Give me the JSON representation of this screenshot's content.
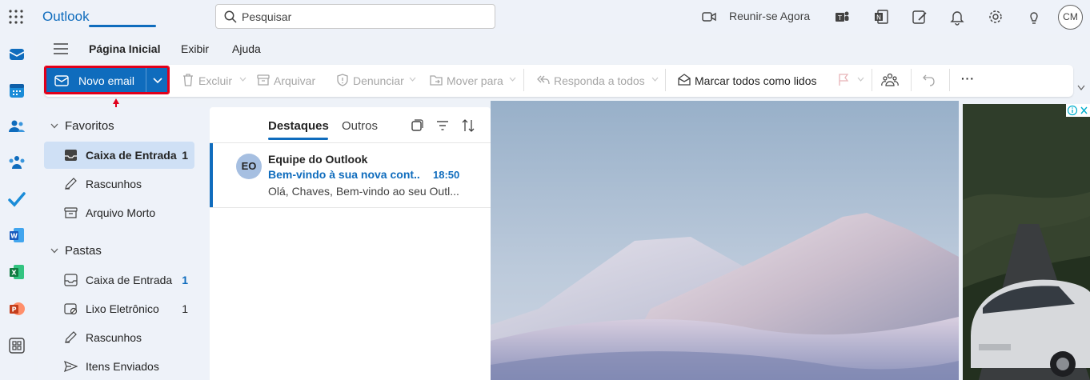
{
  "app": {
    "name": "Outlook"
  },
  "topbar": {
    "search_placeholder": "Pesquisar",
    "meet_now_label": "Reunir-se Agora",
    "avatar_initials": "CM",
    "icons": [
      "waffle-icon",
      "video-icon",
      "teams-icon",
      "onenote-icon",
      "notes-icon",
      "bell-icon",
      "gear-icon",
      "lightbulb-icon"
    ]
  },
  "rail": {
    "items": [
      "mail-icon",
      "calendar-icon",
      "people-icon",
      "groups-icon",
      "todo-icon",
      "word-icon",
      "excel-icon",
      "powerpoint-icon",
      "more-apps-icon"
    ]
  },
  "ribbon": {
    "tabs": [
      "Página Inicial",
      "Exibir",
      "Ajuda"
    ],
    "active_tab": "Página Inicial",
    "new_email_label": "Novo email",
    "actions": {
      "delete": "Excluir",
      "archive": "Arquivar",
      "report": "Denunciar",
      "move": "Mover para",
      "reply_all": "Responda a todos",
      "mark_all_read": "Marcar todos como lidos",
      "more": "···"
    }
  },
  "folders": {
    "favorites_label": "Favoritos",
    "favorites": [
      {
        "label": "Caixa de Entrada",
        "count": "1",
        "selected": true,
        "icon": "inbox-icon"
      },
      {
        "label": "Rascunhos",
        "count": "",
        "icon": "drafts-icon"
      },
      {
        "label": "Arquivo Morto",
        "count": "",
        "icon": "archive-icon"
      }
    ],
    "folders_label": "Pastas",
    "folders": [
      {
        "label": "Caixa de Entrada",
        "count": "1",
        "icon": "inbox-icon"
      },
      {
        "label": "Lixo Eletrônico",
        "count": "1",
        "icon": "junk-icon"
      },
      {
        "label": "Rascunhos",
        "count": "",
        "icon": "drafts-icon"
      },
      {
        "label": "Itens Enviados",
        "count": "",
        "icon": "sent-icon"
      }
    ]
  },
  "message_list": {
    "tabs": [
      "Destaques",
      "Outros"
    ],
    "active_tab": "Destaques",
    "messages": [
      {
        "initials": "EO",
        "from": "Equipe do Outlook",
        "subject": "Bem-vindo à sua nova cont...",
        "time": "18:50",
        "preview": "Olá, Chaves, Bem-vindo ao seu Outl..."
      }
    ]
  },
  "colors": {
    "accent": "#0f6cbd",
    "highlight_border": "#e0001b"
  }
}
